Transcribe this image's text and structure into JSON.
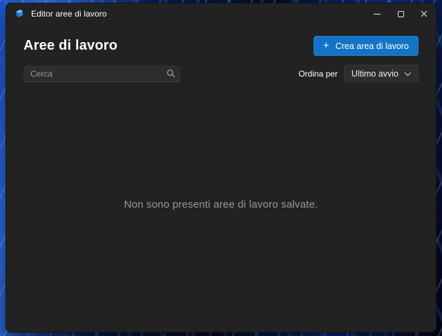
{
  "colors": {
    "accent": "#1374c5",
    "window_bg": "#222222",
    "field_bg": "#2d2d2d",
    "muted_text": "#989898",
    "wallpaper_blue": "#2e6fe8"
  },
  "titlebar": {
    "app_icon": "workspaces-icon",
    "title": "Editor aree di lavoro",
    "controls": [
      {
        "name": "minimize",
        "icon": "minimize-icon"
      },
      {
        "name": "maximize",
        "icon": "maximize-icon"
      },
      {
        "name": "close",
        "icon": "close-icon"
      }
    ]
  },
  "header": {
    "title": "Aree di lavoro",
    "create_button": {
      "icon": "plus-icon",
      "plus_glyph": "+",
      "label": "Crea area di lavoro"
    }
  },
  "toolbar": {
    "search": {
      "placeholder": "Cerca",
      "value": "",
      "icon": "search-icon"
    },
    "sort": {
      "label": "Ordina per",
      "selected_option": "Ultimo avvio",
      "icon": "chevron-down-icon"
    }
  },
  "empty_state": {
    "message": "Non sono presenti aree di lavoro salvate."
  }
}
